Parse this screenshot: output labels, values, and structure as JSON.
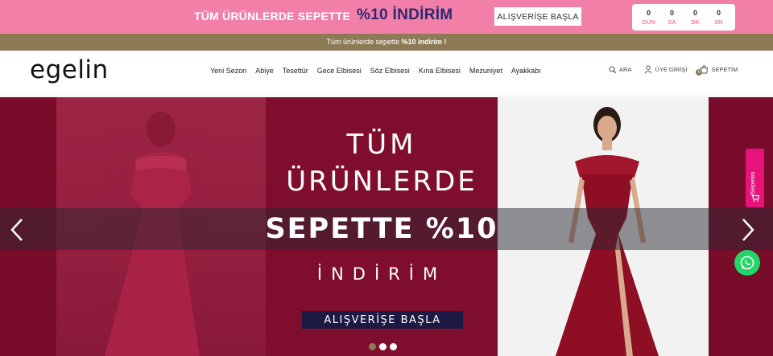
{
  "promo": {
    "text": "TÜM ÜRÜNLERDE SEPETTE",
    "discount": "%10 İNDİRİM",
    "button_label": "ALIŞVERİŞE BAŞLA",
    "countdown": [
      {
        "value": "0",
        "label": "GÜN"
      },
      {
        "value": "0",
        "label": "SA"
      },
      {
        "value": "0",
        "label": "DK"
      },
      {
        "value": "0",
        "label": "SN"
      }
    ],
    "bg_color": "#f27fa8",
    "discount_color": "#2a2a6e"
  },
  "announcement": {
    "text": "Tüm ürünlerde sepette ",
    "bold": "%10 indirim !",
    "bg_color": "#8c7a55"
  },
  "header": {
    "logo": "egelin",
    "nav": [
      "Yeni Sezon",
      "Abiye",
      "Tesettür",
      "Gece Elbisesi",
      "Söz Elbisesi",
      "Kına Elbisesi",
      "Mezuniyet",
      "Ayakkabı"
    ],
    "tools": {
      "search_label": "ARA",
      "login_label": "ÜYE GİRİŞİ",
      "cart_label": "SEPETİM",
      "cart_count": "0"
    }
  },
  "hero": {
    "line1": "TÜM",
    "line2": "ÜRÜNLERDE",
    "line3": "SEPETTE %10",
    "line4": "İNDİRİM",
    "button_label": "ALIŞVERİŞE BAŞLA",
    "accent_color": "#7a0c2b",
    "slides": 3,
    "active_slide": 0
  },
  "side": {
    "tab_text": "Sepetim"
  }
}
